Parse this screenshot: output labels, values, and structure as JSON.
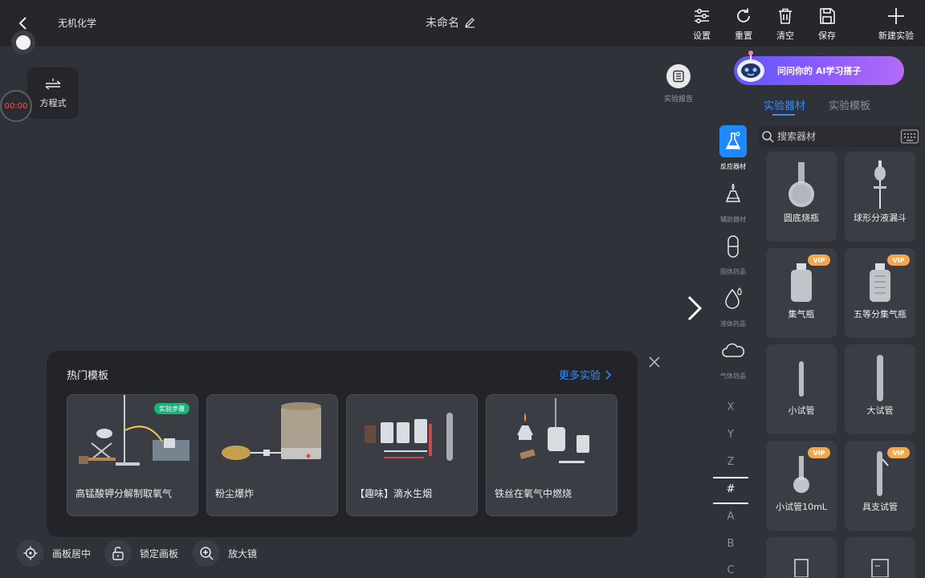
{
  "header": {
    "course": "无机化学",
    "doc_title": "未命名",
    "buttons": [
      {
        "label": "设置",
        "icon": "sliders-icon"
      },
      {
        "label": "重置",
        "icon": "refresh-icon"
      },
      {
        "label": "清空",
        "icon": "trash-icon"
      },
      {
        "label": "保存",
        "icon": "save-icon"
      },
      {
        "label": "新建实验",
        "icon": "plus-icon"
      }
    ]
  },
  "left_tools": {
    "equation_label": "方程式",
    "timer": "00:00"
  },
  "report": {
    "label": "实验报告"
  },
  "ai": {
    "banner": "问问你的 AI学习搭子"
  },
  "panel": {
    "tabs": [
      {
        "label": "实验器材",
        "active": true
      },
      {
        "label": "实验模板",
        "active": false
      }
    ],
    "search_placeholder": "搜索器材",
    "categories": [
      {
        "label": "反应器材",
        "icon": "flask-icon",
        "active": true
      },
      {
        "label": "辅助器材",
        "icon": "burner-icon",
        "active": false
      },
      {
        "label": "固体药品",
        "icon": "capsule-icon",
        "active": false
      },
      {
        "label": "液体药品",
        "icon": "droplet-icon",
        "active": false
      },
      {
        "label": "气体药品",
        "icon": "cloud-icon",
        "active": false
      }
    ],
    "index_letters": [
      "X",
      "Y",
      "Z",
      "#",
      "A",
      "B",
      "C"
    ],
    "active_letter": "#",
    "items": [
      {
        "label": "圆底烧瓶",
        "vip": false,
        "icon": "round-flask-icon"
      },
      {
        "label": "球形分液漏斗",
        "vip": false,
        "icon": "separatory-funnel-icon"
      },
      {
        "label": "集气瓶",
        "vip": true,
        "icon": "gas-bottle-icon"
      },
      {
        "label": "五等分集气瓶",
        "vip": true,
        "icon": "graduated-bottle-icon"
      },
      {
        "label": "小试管",
        "vip": false,
        "icon": "small-tube-icon"
      },
      {
        "label": "大试管",
        "vip": false,
        "icon": "large-tube-icon"
      },
      {
        "label": "小试管10mL",
        "vip": true,
        "icon": "tube-10ml-icon"
      },
      {
        "label": "具支试管",
        "vip": true,
        "icon": "branch-tube-icon"
      }
    ],
    "vip_label": "VIP"
  },
  "hot": {
    "title": "热门模板",
    "more": "更多实验",
    "step_badge": "实验步骤",
    "templates": [
      {
        "label": "高锰酸钾分解制取氧气"
      },
      {
        "label": "粉尘爆炸"
      },
      {
        "label": "【趣味】滴水生烟"
      },
      {
        "label": "铁丝在氧气中燃烧"
      }
    ]
  },
  "bottom": [
    {
      "label": "画板居中",
      "icon": "target-icon"
    },
    {
      "label": "锁定画板",
      "icon": "lock-icon"
    },
    {
      "label": "放大镜",
      "icon": "magnifier-icon"
    }
  ],
  "colors": {
    "accent": "#3a8cff",
    "vip": "#f5a84b",
    "badge": "#19b37a",
    "timer": "#ff4d4f"
  }
}
